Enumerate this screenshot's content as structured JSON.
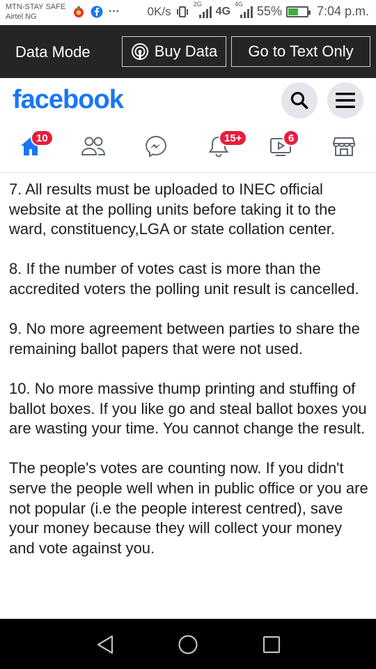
{
  "status_bar": {
    "carrier_line1": "MTN-STAY SAFE",
    "carrier_line2": "Airtel NG",
    "more_dots": "···",
    "speed": "0K/s",
    "net1": "2G",
    "net2": "4G",
    "net3": "4G",
    "battery_percent": "55%",
    "battery_level": 0.55,
    "time": "7:04 p.m."
  },
  "data_bar": {
    "mode_label": "Data Mode",
    "buy_data_label": "Buy Data",
    "text_only_label": "Go to Text Only"
  },
  "header": {
    "logo": "facebook",
    "accent_color": "#1877f2"
  },
  "nav": {
    "home_badge": "10",
    "notifications_badge": "15+",
    "watch_badge": "6"
  },
  "post": {
    "paragraphs": [
      "7. All results must be uploaded to INEC official website at the polling units before taking it to the ward, constituency,LGA or state collation center.",
      "8. If the number of votes cast is more than the accredited voters the polling unit result is cancelled.",
      "9. No more agreement between parties to share the remaining ballot papers that were not used.",
      "10. No more massive thump printing and stuffing of ballot boxes. If you like go and steal ballot boxes you are wasting your time. You cannot change the result.",
      "The people's votes are counting now. If you didn't serve the people well when in public office or you are not popular (i.e the people interest centred), save your money because they will collect your money and vote against you."
    ]
  }
}
